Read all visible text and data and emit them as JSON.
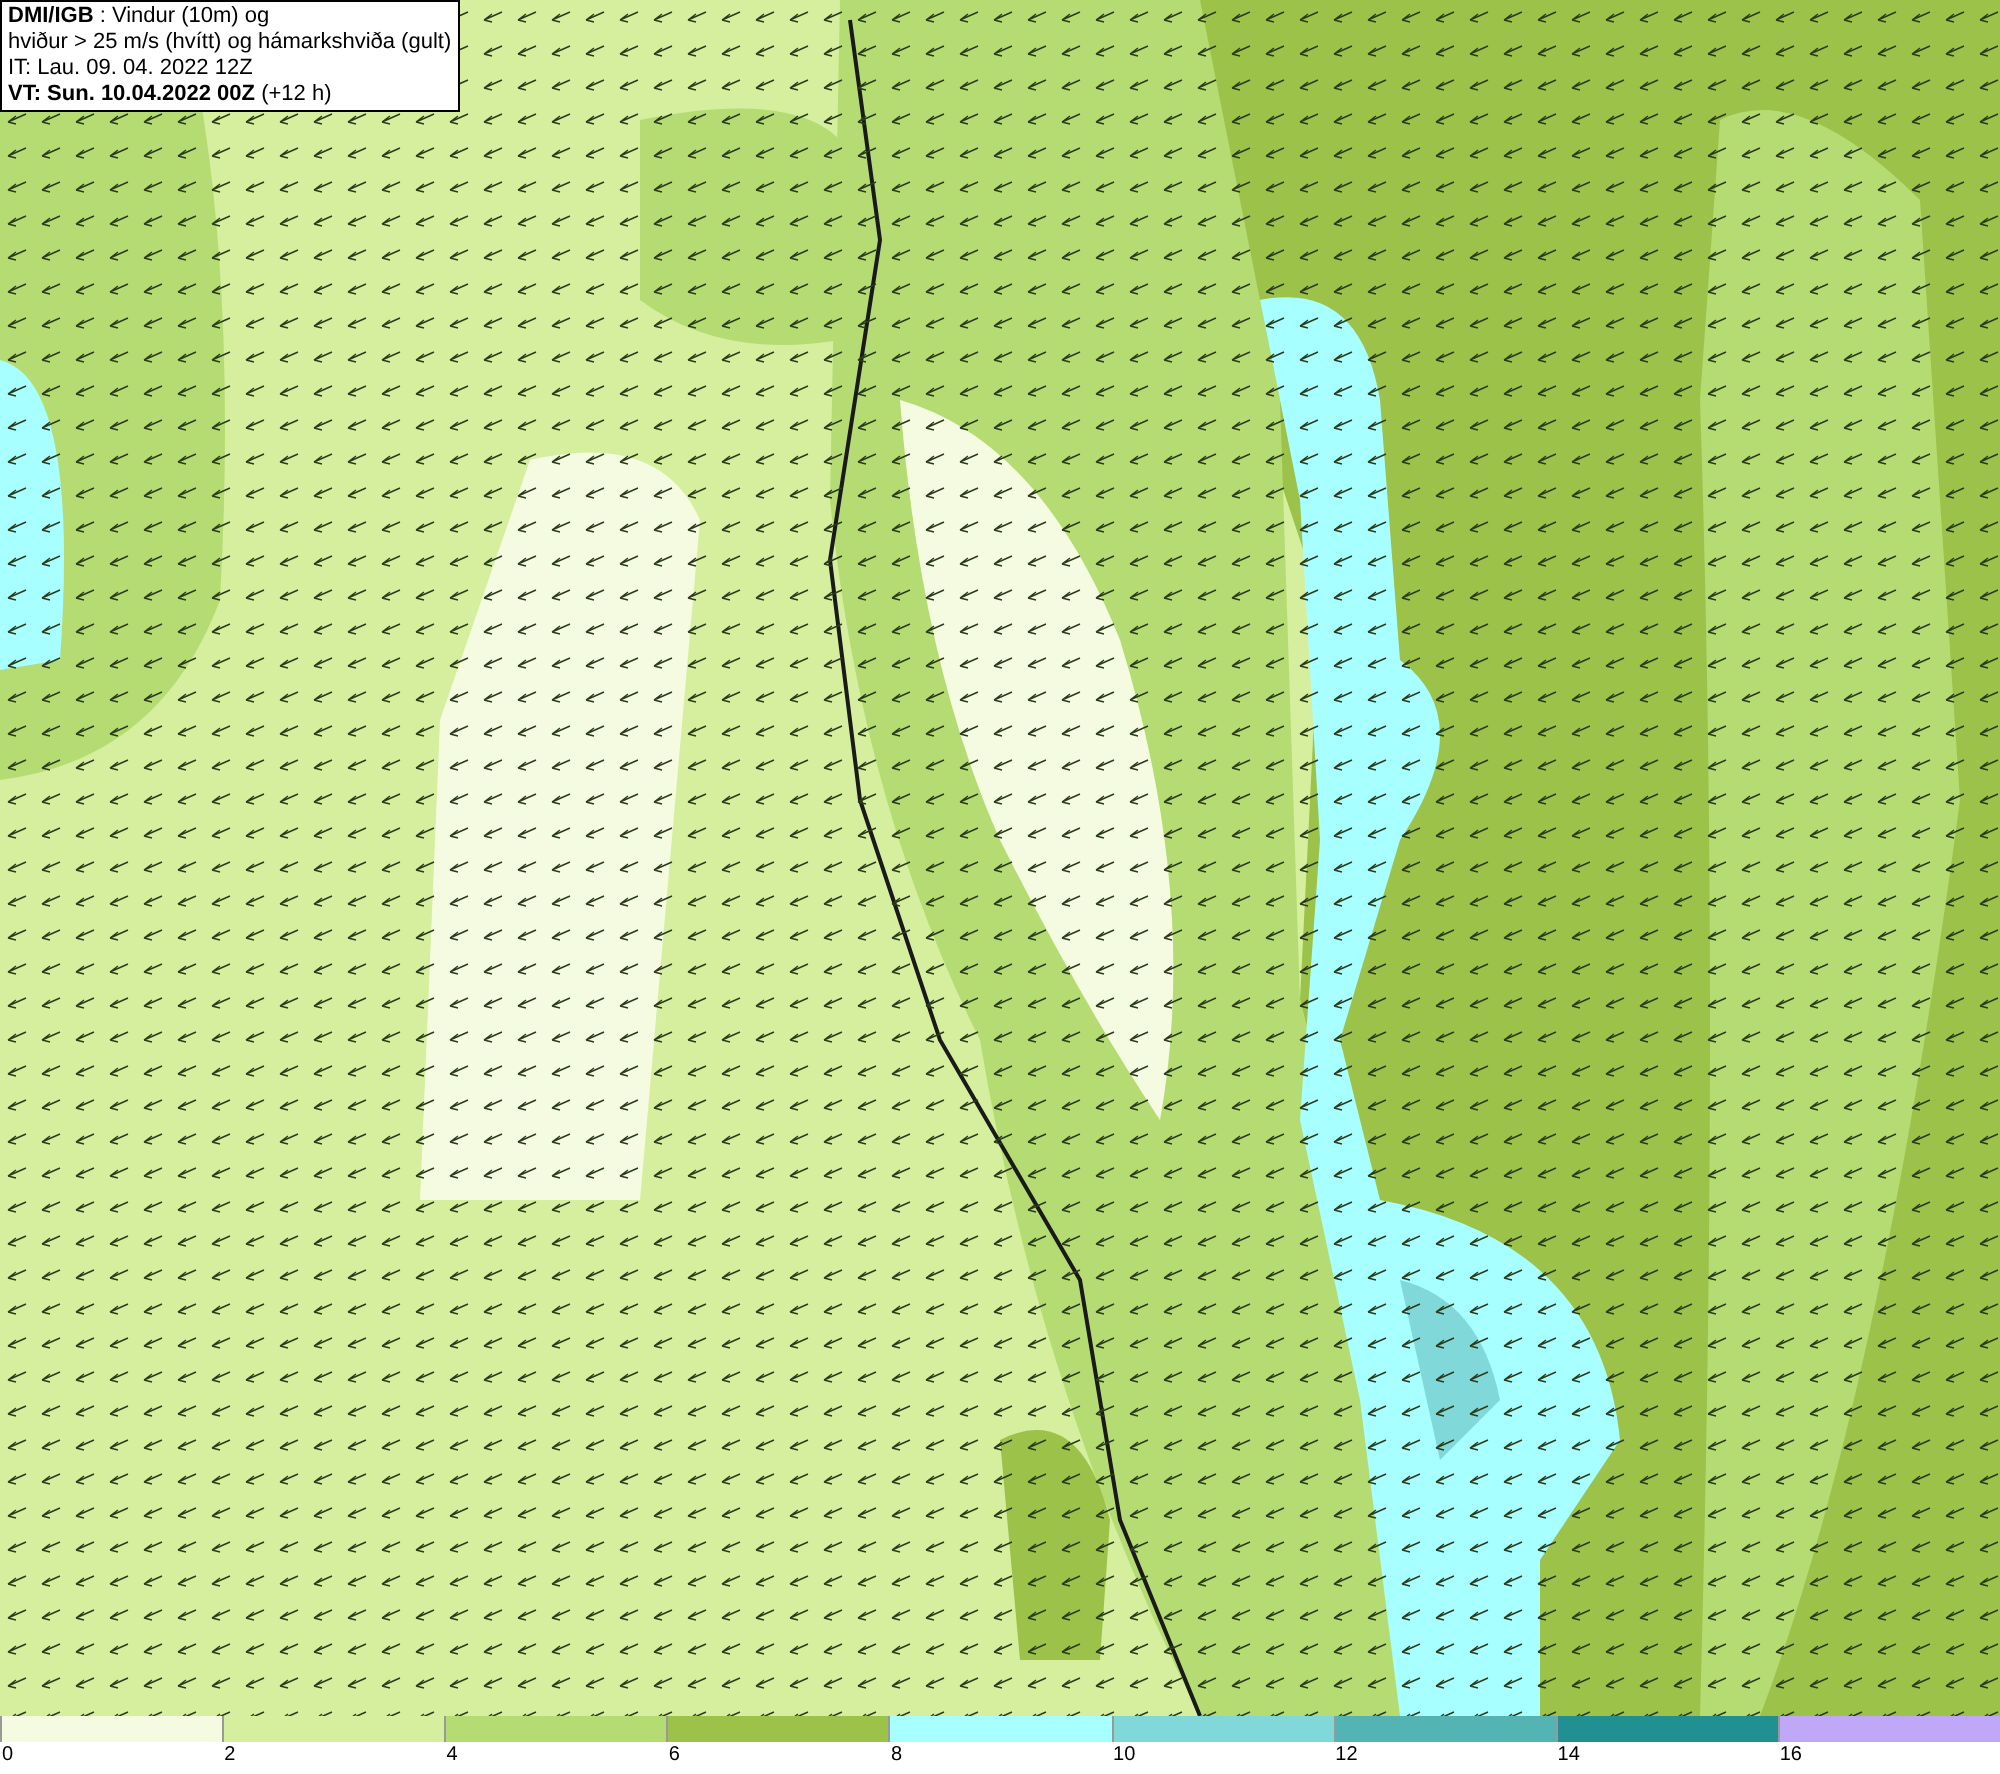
{
  "header": {
    "lines": [
      "**DMI/IGB** : Vindur (10m) og",
      "hviður > 25 m/s (hvítt) og hámarkshviða (gult)",
      "IT: Lau. 09. 04. 2022 12Z",
      "**VT: Sun. 10.04.2022 00Z** (+12 h)"
    ]
  },
  "legend": {
    "bins": [
      {
        "label": "0",
        "color": "#f5fbe0"
      },
      {
        "label": "2",
        "color": "#d5ef9e"
      },
      {
        "label": "4",
        "color": "#b5dc72"
      },
      {
        "label": "6",
        "color": "#9cc24a"
      },
      {
        "label": "8",
        "color": "#a8ffff"
      },
      {
        "label": "10",
        "color": "#80d8d8"
      },
      {
        "label": "12",
        "color": "#54b4b4"
      },
      {
        "label": "14",
        "color": "#209090"
      },
      {
        "label": "16",
        "color": "#bfa8f8"
      }
    ]
  }
}
